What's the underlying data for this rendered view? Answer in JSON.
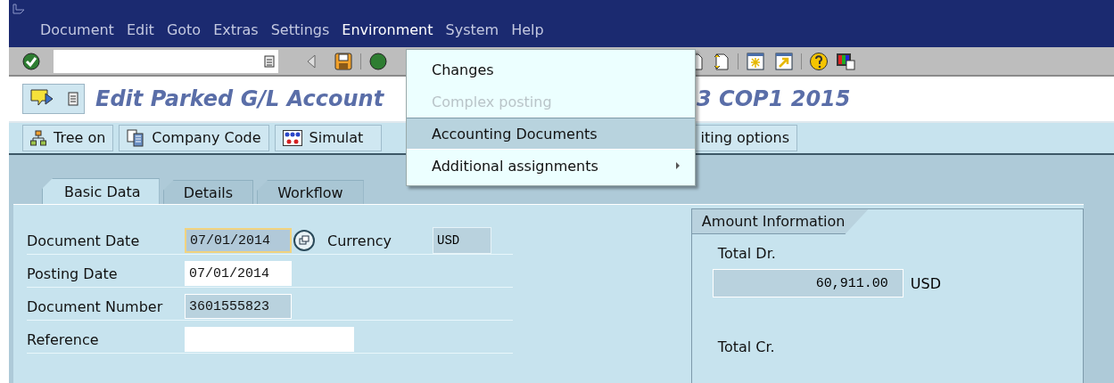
{
  "menu_bar": {
    "items": [
      {
        "label": "Document",
        "selected": false
      },
      {
        "label": "Edit",
        "selected": false
      },
      {
        "label": "Goto",
        "selected": false
      },
      {
        "label": "Extras",
        "selected": false
      },
      {
        "label": "Settings",
        "selected": false
      },
      {
        "label": "Environment",
        "selected": true
      },
      {
        "label": "System",
        "selected": false
      },
      {
        "label": "Help",
        "selected": false
      }
    ]
  },
  "dropdown": {
    "items": [
      {
        "label": "Changes",
        "disabled": false,
        "selected": false,
        "submenu": false
      },
      {
        "label": "Complex posting",
        "disabled": true,
        "selected": false,
        "submenu": false
      },
      {
        "label": "Accounting Documents",
        "disabled": false,
        "selected": true,
        "submenu": false
      },
      {
        "label": "Additional assignments",
        "disabled": false,
        "selected": false,
        "submenu": true
      }
    ]
  },
  "title": {
    "left": "Edit Parked G/L Account",
    "right": "3 COP1 2015"
  },
  "application_toolbar": {
    "buttons": [
      {
        "label": "Tree on"
      },
      {
        "label": "Company Code"
      },
      {
        "label": "Simulat"
      },
      {
        "label": "iting options"
      }
    ]
  },
  "tabs": [
    {
      "label": "Basic Data",
      "selected": true
    },
    {
      "label": "Details",
      "selected": false
    },
    {
      "label": "Workflow",
      "selected": false
    }
  ],
  "basic_data": {
    "fields": [
      {
        "label": "Document Date",
        "value": "07/01/2014",
        "kind": "readonly",
        "focused": true,
        "extra_label": "Currency",
        "extra_value": "USD"
      },
      {
        "label": "Posting Date",
        "value": "07/01/2014",
        "kind": "editable",
        "focused": false
      },
      {
        "label": "Document Number",
        "value": "3601555823",
        "kind": "readonly",
        "focused": false
      },
      {
        "label": "Reference",
        "kind": "editable_long",
        "focused": false
      }
    ]
  },
  "amount_information": {
    "title": "Amount Information",
    "total_dr_label": "Total Dr.",
    "total_dr_value": "60,911.00",
    "total_dr_currency": "USD",
    "total_cr_label": "Total Cr."
  }
}
